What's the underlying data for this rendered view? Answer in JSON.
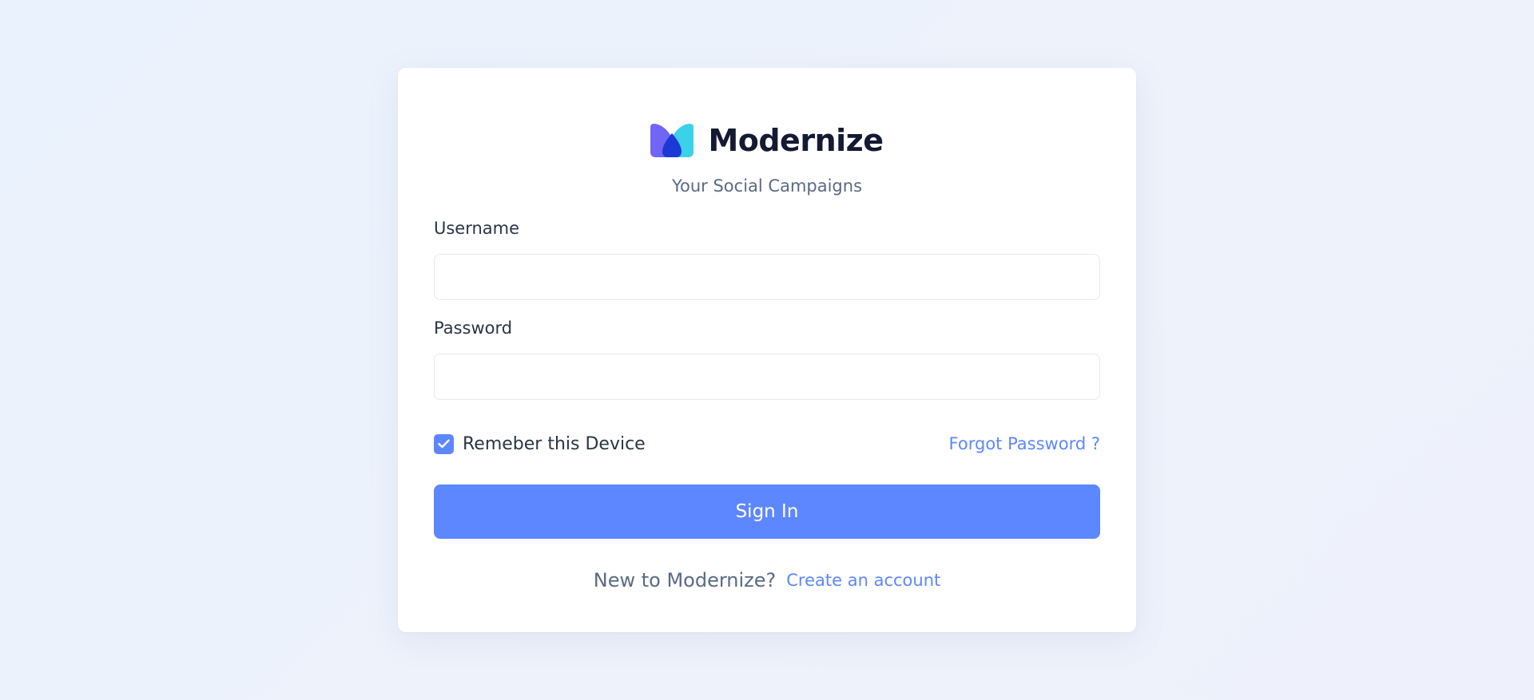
{
  "brand": {
    "name": "Modernize",
    "tagline": "Your Social Campaigns",
    "logo_icon": "modernize-logo-icon"
  },
  "form": {
    "username_label": "Username",
    "username_value": "",
    "password_label": "Password",
    "password_value": "",
    "remember_label": "Remeber this Device",
    "remember_checked": true,
    "forgot_label": "Forgot Password ?",
    "submit_label": "Sign In"
  },
  "footer": {
    "prompt": "New to Modernize?",
    "create_label": "Create an account"
  },
  "colors": {
    "primary": "#5d87ff",
    "heading": "#141a33",
    "text": "#2a3547",
    "muted": "#5a6a85",
    "background": "#ecf2fc"
  }
}
